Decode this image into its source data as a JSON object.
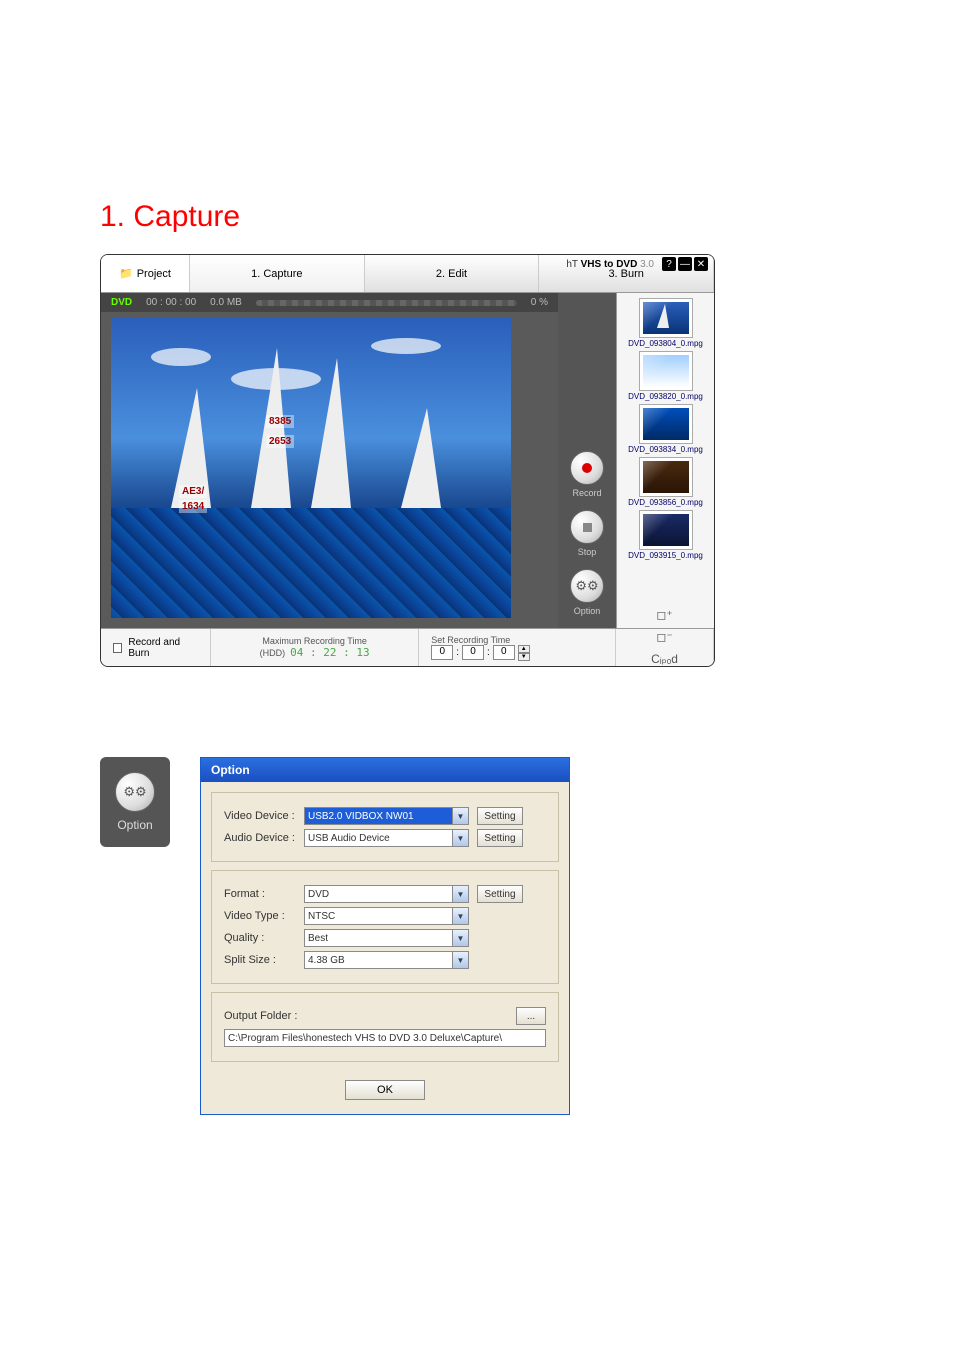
{
  "page_heading": "1. Capture",
  "app": {
    "title_brand_prefix": "hT",
    "title_brand": "VHS to DVD",
    "title_version": "3.0",
    "project_label": "Project",
    "tabs": {
      "t1": "1. Capture",
      "t2": "2. Edit",
      "t3": "3. Burn"
    },
    "preview_header": {
      "disc": "DVD",
      "timecode": "00 : 00 : 00",
      "size": "0.0 MB",
      "percent": "0 %"
    },
    "sail_numbers": {
      "n1": "8385",
      "n2": "2653",
      "n3a": "AE3/",
      "n3b": "1634"
    },
    "controls": {
      "record": "Record",
      "stop": "Stop",
      "option": "Option"
    },
    "clips": [
      "DVD_093804_0.mpg",
      "DVD_093820_0.mpg",
      "DVD_093834_0.mpg",
      "DVD_093856_0.mpg",
      "DVD_093915_0.mpg"
    ],
    "footer": {
      "record_and_burn": "Record and Burn",
      "max_label": "Maximum Recording Time",
      "hdd": "(HDD)",
      "max_time": "04 : 22 : 13",
      "set_label": "Set Recording Time",
      "set_h": "0",
      "set_m": "0",
      "set_s": "0"
    }
  },
  "option_launcher_label": "Option",
  "dialog": {
    "title": "Option",
    "video_device_label": "Video Device :",
    "video_device_value": "USB2.0 VIDBOX NW01",
    "audio_device_label": "Audio Device :",
    "audio_device_value": "USB Audio Device",
    "setting_btn": "Setting",
    "format_label": "Format :",
    "format_value": "DVD",
    "videotype_label": "Video Type :",
    "videotype_value": "NTSC",
    "quality_label": "Quality :",
    "quality_value": "Best",
    "split_label": "Split Size :",
    "split_value": "4.38 GB",
    "output_label": "Output Folder :",
    "browse": "...",
    "output_path": "C:\\Program Files\\honestech VHS to DVD 3.0 Deluxe\\Capture\\",
    "ok": "OK"
  }
}
